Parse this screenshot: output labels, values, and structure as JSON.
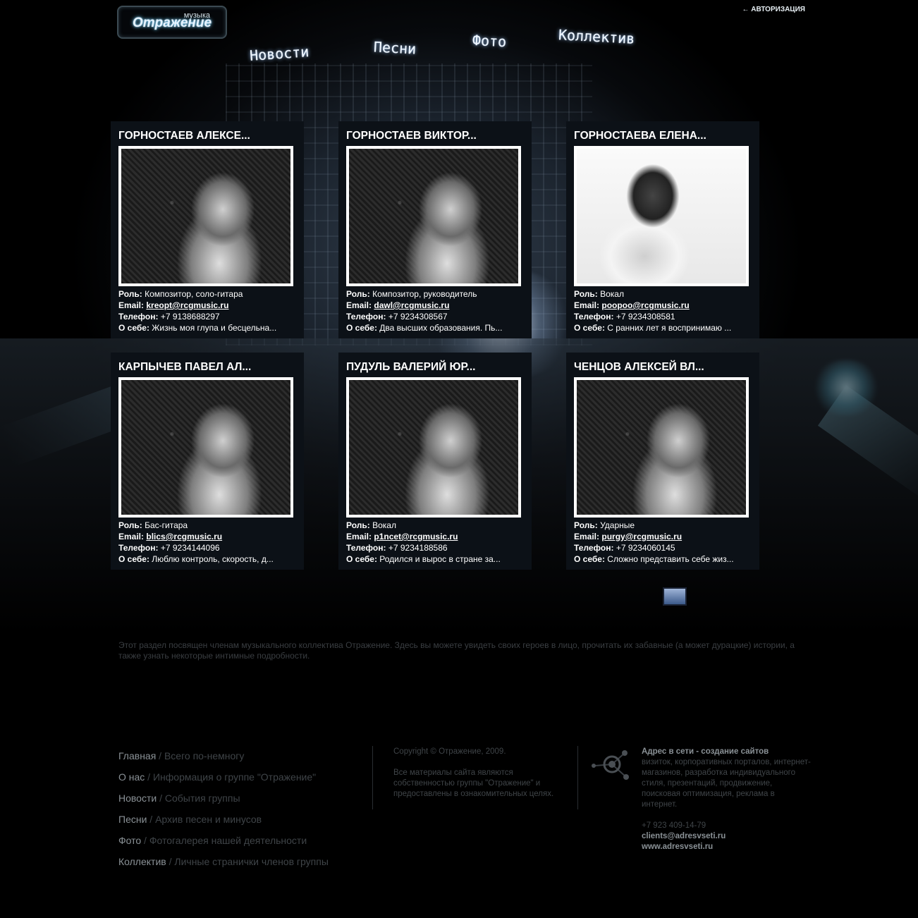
{
  "header": {
    "logo_small": "музыка",
    "logo_big": "Отражение",
    "auth_link": "← АВТОРИЗАЦИЯ"
  },
  "nav": {
    "news": "Новости",
    "songs": "Песни",
    "photo": "Фото",
    "team": "Коллектив"
  },
  "labels": {
    "role": "Роль:",
    "email": "Email:",
    "phone": "Телефон:",
    "about": "О себе:"
  },
  "members": [
    {
      "name": "ГОРНОСТАЕВ АЛЕКСЕ...",
      "role": "Композитор, соло-гитара",
      "email": "kreopt@rcgmusic.ru",
      "phone": "+7 9138688297",
      "about": "Жизнь моя глупа и бесцельна..."
    },
    {
      "name": "ГОРНОСТАЕВ ВИКТОР...",
      "role": "Композитор, руководитель",
      "email": "dawl@rcgmusic.ru",
      "phone": "+7 9234308567",
      "about": "Два высших образования. Пь..."
    },
    {
      "name": "ГОРНОСТАЕВА ЕЛЕНА...",
      "role": "Вокал",
      "email": "poopoo@rcgmusic.ru",
      "phone": "+7 9234308581",
      "about": "С ранних лет я воспринимаю ..."
    },
    {
      "name": "КАРПЫЧЕВ ПАВЕЛ АЛ...",
      "role": "Бас-гитара",
      "email": "blics@rcgmusic.ru",
      "phone": "+7 9234144096",
      "about": "Люблю контроль, скорость, д..."
    },
    {
      "name": "ПУДУЛЬ ВАЛЕРИЙ ЮР...",
      "role": "Вокал",
      "email": "p1ncet@rcgmusic.ru",
      "phone": "+7 9234188586",
      "about": "Родился и вырос в стране за..."
    },
    {
      "name": "ЧЕНЦОВ АЛЕКСЕЙ ВЛ...",
      "role": "Ударные",
      "email": "purgy@rcgmusic.ru",
      "phone": "+7 9234060145",
      "about": "Сложно представить себе жиз..."
    }
  ],
  "description": "Этот раздел посвящен членам музыкального коллектива Отражение. Здесь вы можете увидеть своих героев в лицо, прочитать их забавные (а может дурацкие) истории, а также узнать некоторые интимные подробности.",
  "footer": {
    "nav": [
      {
        "label": "Главная",
        "desc": " / Всего по-немногу"
      },
      {
        "label": "О нас",
        "desc": " / Информация о группе \"Отражение\""
      },
      {
        "label": "Новости",
        "desc": " / События группы"
      },
      {
        "label": "Песни",
        "desc": " / Архив песен и минусов"
      },
      {
        "label": "Фото",
        "desc": " / Фотогалерея нашей деятельности"
      },
      {
        "label": "Коллектив",
        "desc": " / Личные странички членов группы"
      }
    ],
    "copyright": "Copyright © Отражение, 2009.",
    "rights": "Все материалы сайта являются собственностью группы \"Отражение\" и предоставлены в ознакомительных целях.",
    "studio_name": "Адрес в сети",
    "studio_tagline": " - создание сайтов",
    "studio_desc": "визиток, корпоративных порталов, интернет-магазинов, разработка индивидуального стиля, презентаций, продвижение, поисковая оптимизация, реклама в интернет.",
    "studio_phone": "+7 923 409-14-79",
    "studio_email": "clients@adresvseti.ru",
    "studio_site": "www.adresvseti.ru"
  },
  "colors": {
    "card_bg": "#0c1117",
    "footer_text": "#3f4448",
    "footer_link": "#8a9196"
  }
}
